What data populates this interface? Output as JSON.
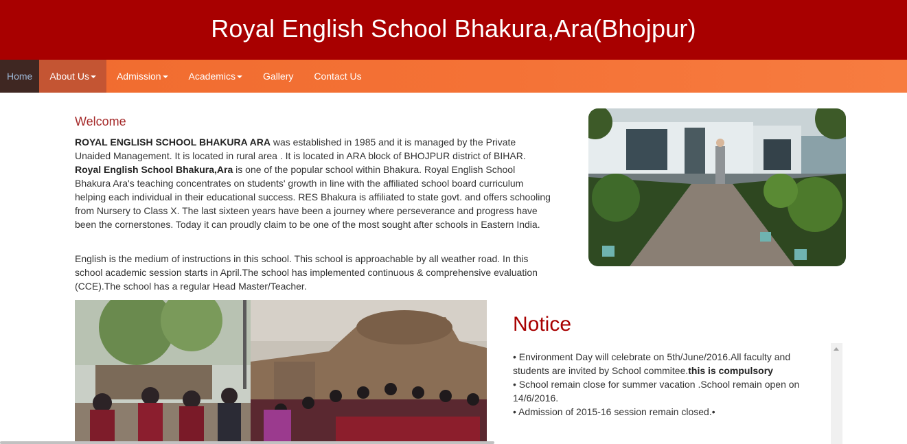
{
  "header": {
    "title": "Royal English School Bhakura,Ara(Bhojpur)"
  },
  "nav": {
    "items": [
      {
        "label": "Home"
      },
      {
        "label": "About Us"
      },
      {
        "label": "Admission"
      },
      {
        "label": "Academics"
      },
      {
        "label": "Gallery"
      },
      {
        "label": "Contact Us"
      }
    ]
  },
  "welcome": {
    "title": "Welcome",
    "p1_bold1": "ROYAL ENGLISH SCHOOL BHAKURA ARA",
    "p1_text1": " was established in 1985 and it is managed by the Private Unaided Management. It is located in rural area . It is located in ARA block of BHOJPUR district of BIHAR. ",
    "p1_bold2": "Royal English School Bhakura,Ara",
    "p1_text2": " is one of the popular school within Bhakura. Royal English School Bhakura Ara's teaching concentrates on students' growth in line with the affiliated school board curriculum helping each individual in their educational success. RES Bhakura is affiliated to state govt. and offers schooling from Nursery to Class X. The last sixteen years have been a journey where perseverance and progress have been the cornerstones. Today it can proudly claim to be one of the most sought after schools in Eastern India.",
    "p2": "English is the medium of instructions in this school. This school is approachable by all weather road. In this school academic session starts in April.The school has implemented continuous & comprehensive evaluation (CCE).The school has a regular Head Master/Teacher."
  },
  "notice": {
    "title": "Notice",
    "items": [
      {
        "text": "•  Environment Day will celebrate on 5th/June/2016.All faculty and students are invited by School commitee.",
        "bold": "this is compulsory"
      },
      {
        "text": "•  School remain close for summer vacation .School remain open on 14/6/2016.",
        "bold": ""
      },
      {
        "text": "•  Admission of 2015-16 session remain closed.•",
        "bold": ""
      }
    ]
  },
  "colors": {
    "header_bg": "#a80000",
    "nav_bg": "#f47236",
    "nav_active_bg": "#3f2722",
    "welcome_title": "#a52a2a",
    "notice_title": "#a80000"
  }
}
